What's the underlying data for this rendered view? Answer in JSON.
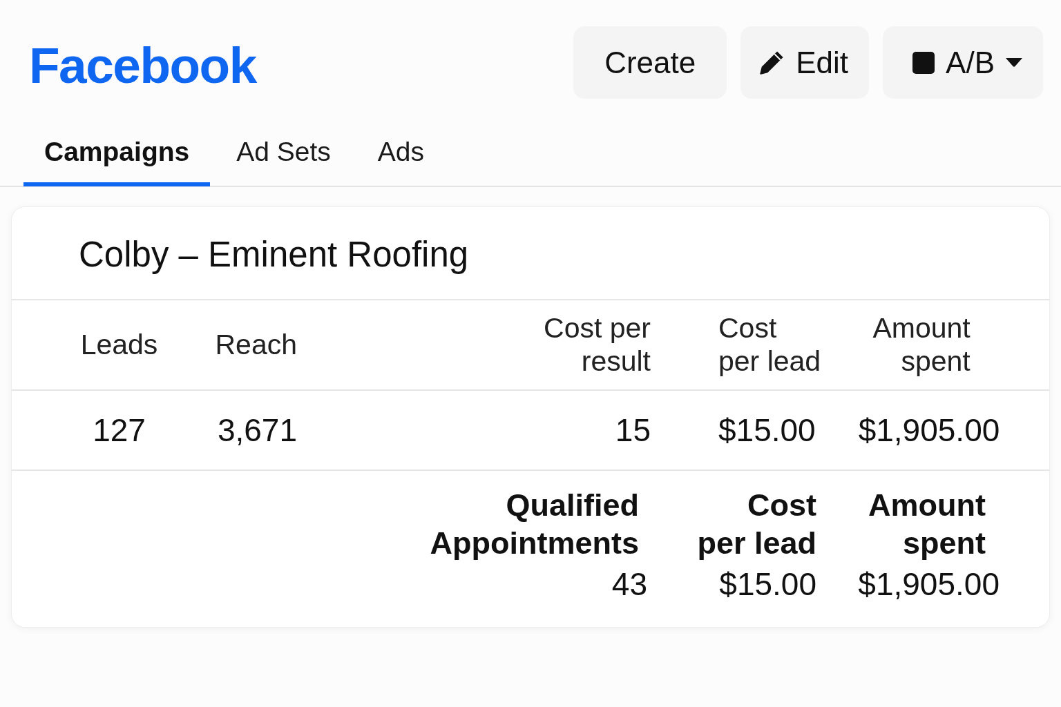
{
  "header": {
    "logo": "Facebook",
    "buttons": [
      {
        "kind": "plain",
        "label": "Create"
      },
      {
        "kind": "edit",
        "label": "Edit"
      },
      {
        "kind": "dropdown",
        "label": "A/B"
      }
    ]
  },
  "tabs": [
    {
      "label": "Campaigns",
      "selected": true
    },
    {
      "label": "Ad Sets",
      "selected": false
    },
    {
      "label": "Ads",
      "selected": false
    }
  ],
  "campaign": {
    "title": "Colby – Eminent Roofing",
    "table": {
      "columns": [
        "Leads",
        "Reach",
        "Cost per result",
        "Cost per lead",
        "Amount spent"
      ],
      "rows": [
        [
          "127",
          "3,671",
          "15",
          "$15.00",
          "$1,905.00"
        ]
      ]
    },
    "summary": [
      {
        "label": "Qualified Appointments",
        "value": "43"
      },
      {
        "label": "Cost per lead",
        "value": "$15.00"
      },
      {
        "label": "Amount spent",
        "value": "$1,905.00"
      }
    ]
  }
}
